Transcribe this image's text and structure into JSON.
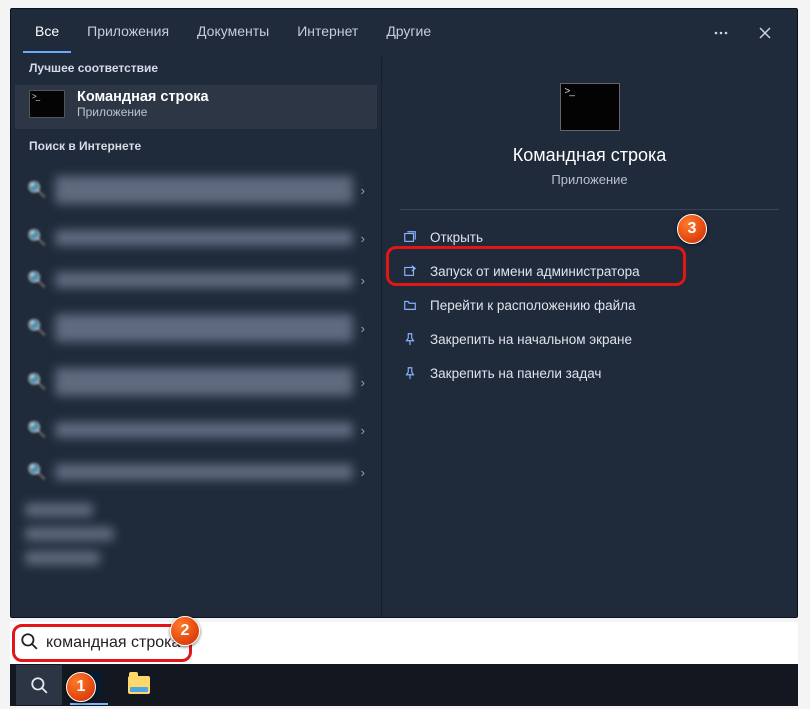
{
  "tabs": {
    "items": [
      {
        "label": "Все",
        "active": true
      },
      {
        "label": "Приложения",
        "active": false
      },
      {
        "label": "Документы",
        "active": false
      },
      {
        "label": "Интернет",
        "active": false
      },
      {
        "label": "Другие",
        "active": false
      }
    ]
  },
  "left": {
    "best_match_header": "Лучшее соответствие",
    "app_title": "Командная строка",
    "app_subtitle": "Приложение",
    "web_header": "Поиск в Интернете"
  },
  "preview": {
    "title": "Командная строка",
    "subtitle": "Приложение"
  },
  "actions": [
    {
      "label": "Открыть",
      "icon": "open"
    },
    {
      "label": "Запуск от имени администратора",
      "icon": "admin"
    },
    {
      "label": "Перейти к расположению файла",
      "icon": "folder"
    },
    {
      "label": "Закрепить на начальном экране",
      "icon": "pin"
    },
    {
      "label": "Закрепить на панели задач",
      "icon": "pin"
    }
  ],
  "search": {
    "value": "командная строка"
  },
  "steps": {
    "s1": "1",
    "s2": "2",
    "s3": "3"
  }
}
